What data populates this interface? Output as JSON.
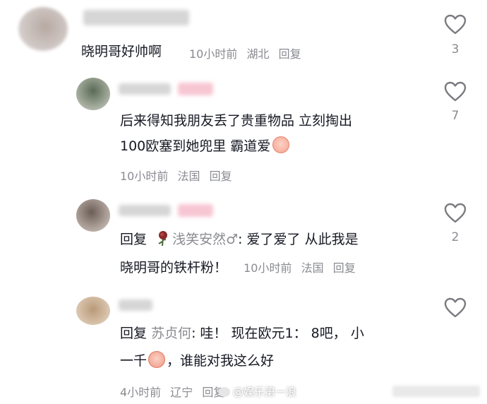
{
  "comments": [
    {
      "text": "晓明哥好帅啊",
      "meta": {
        "time": "10小时前",
        "location": "湖北",
        "reply": "回复"
      },
      "likes": "3"
    },
    {
      "lines": [
        "后来得知我朋友丢了贵重物品 立刻掏出",
        "100欧塞到她兜里 霸道爱"
      ],
      "meta": {
        "time": "10小时前",
        "location": "法国",
        "reply": "回复"
      },
      "likes": "7"
    },
    {
      "reply_prefix": "回复",
      "reply_to": "浅笑安然♂",
      "line1_rest": ": 爱了爱了 从此我是",
      "line2": "晓明哥的铁杆粉！",
      "meta": {
        "time": "10小时前",
        "location": "法国",
        "reply": "回复"
      },
      "likes": "2"
    },
    {
      "reply_prefix": "回复",
      "reply_to": "苏贞何",
      "line1_rest": ": 哇！ 现在欧元1： 8吧， 小",
      "line2_a": "一千",
      "line2_b": "，谁能对我这么好",
      "meta": {
        "time": "4小时前",
        "location": "辽宁",
        "reply": "回复"
      }
    }
  ],
  "watermark": "@娱乐第一浪",
  "colors": {
    "text": "#161823",
    "meta": "#8a8b91",
    "icon": "#7a7b80"
  }
}
